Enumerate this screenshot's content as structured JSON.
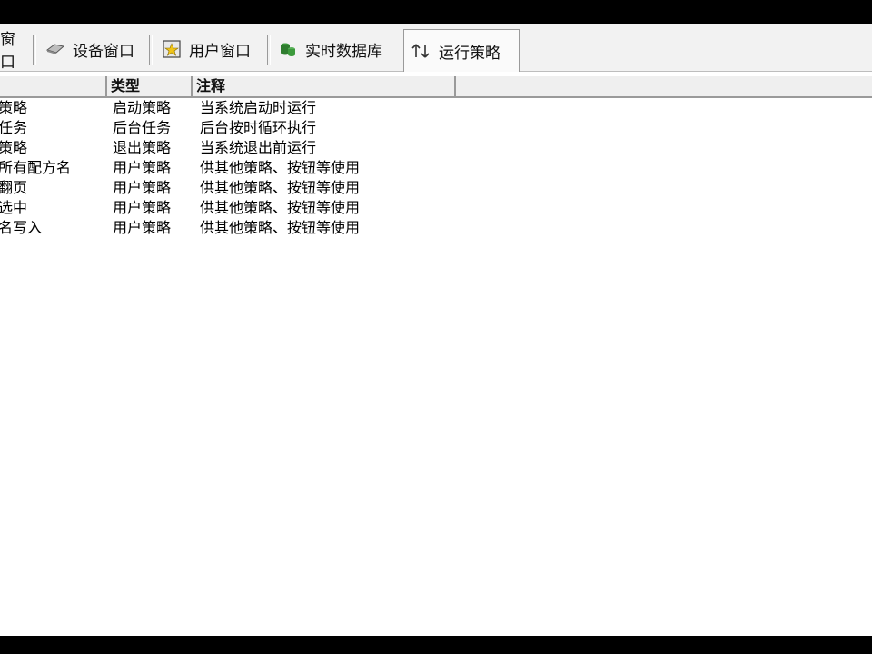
{
  "tabs": [
    {
      "label": "窗口",
      "icon": "window-icon"
    },
    {
      "label": "设备窗口",
      "icon": "device-icon"
    },
    {
      "label": "用户窗口",
      "icon": "user-window-icon"
    },
    {
      "label": "实时数据库",
      "icon": "database-icon"
    },
    {
      "label": "运行策略",
      "icon": "strategy-icon",
      "active": true
    }
  ],
  "table": {
    "columns": [
      "",
      "类型",
      "注释"
    ],
    "rows": [
      {
        "name": "策略",
        "type": "启动策略",
        "note": "当系统启动时运行"
      },
      {
        "name": "任务",
        "type": "后台任务",
        "note": "后台按时循环执行"
      },
      {
        "name": "策略",
        "type": "退出策略",
        "note": "当系统退出前运行"
      },
      {
        "name": "所有配方名",
        "type": "用户策略",
        "note": "供其他策略、按钮等使用"
      },
      {
        "name": "翻页",
        "type": "用户策略",
        "note": "供其他策略、按钮等使用"
      },
      {
        "name": "选中",
        "type": "用户策略",
        "note": "供其他策略、按钮等使用"
      },
      {
        "name": "名写入",
        "type": "用户策略",
        "note": "供其他策略、按钮等使用"
      }
    ]
  },
  "colors": {
    "tabbar_bg": "#f2f2f2",
    "header_bg": "#efefef",
    "content_bg": "#ffffff"
  }
}
